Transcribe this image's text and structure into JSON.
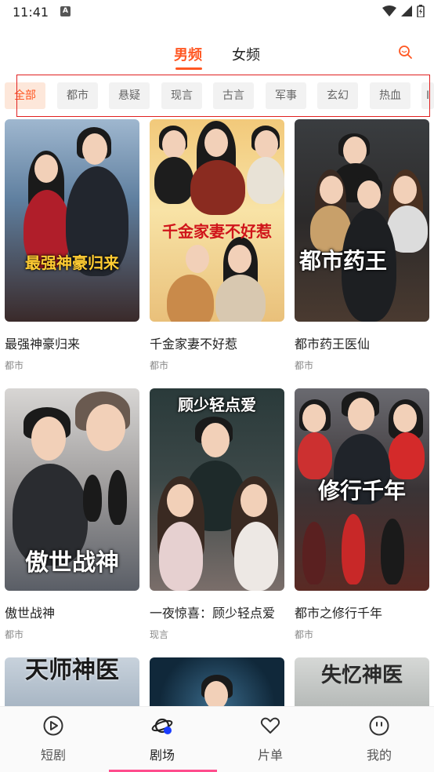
{
  "status_bar": {
    "time": "11:41",
    "notification_icon": "A"
  },
  "top_tabs": {
    "male": "男频",
    "female": "女频",
    "accent_color": "#ff5722"
  },
  "categories": [
    "全部",
    "都市",
    "悬疑",
    "现言",
    "古言",
    "军事",
    "玄幻",
    "热血",
    "I"
  ],
  "dramas": [
    {
      "title": "最强神豪归来",
      "tag": "都市",
      "poster_text": "最强神豪归来"
    },
    {
      "title": "千金家妻不好惹",
      "tag": "都市",
      "poster_text": "千金家妻不好惹"
    },
    {
      "title": "都市药王医仙",
      "tag": "都市",
      "poster_text": "都市药王"
    },
    {
      "title": "傲世战神",
      "tag": "都市",
      "poster_text": "傲世战神"
    },
    {
      "title": "一夜惊喜：顾少轻点爱",
      "tag": "现言",
      "poster_text": "顾少轻点爱"
    },
    {
      "title": "都市之修行千年",
      "tag": "都市",
      "poster_text": "修行千年"
    },
    {
      "title": "",
      "tag": "",
      "poster_text": "天师神医"
    },
    {
      "title": "",
      "tag": "",
      "poster_text": ""
    },
    {
      "title": "",
      "tag": "",
      "poster_text": "失忆神医"
    }
  ],
  "bottom_nav": [
    {
      "label": "短剧",
      "icon": "play-circle-icon"
    },
    {
      "label": "剧场",
      "icon": "planet-icon"
    },
    {
      "label": "片单",
      "icon": "heart-icon"
    },
    {
      "label": "我的",
      "icon": "smiley-icon"
    }
  ],
  "active_nav_index": 1
}
